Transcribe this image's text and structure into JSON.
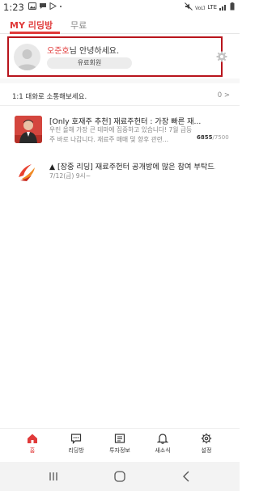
{
  "status_bar": {
    "time": "1:23",
    "network": "LTE",
    "icons": [
      "gallery-icon",
      "message-icon",
      "play-store-icon",
      "dot-icon",
      "mute-icon",
      "volte-icon",
      "signal-icon",
      "battery-icon"
    ]
  },
  "tabs": [
    {
      "label": "MY 리딩방",
      "active": true
    },
    {
      "label": "무료",
      "active": false
    }
  ],
  "profile": {
    "user_name": "오준호",
    "greeting_suffix": "님 안녕하세요.",
    "member_type": "유료회원"
  },
  "chat_prompt": {
    "text": "1:1 대화로 소통해보세요.",
    "count": "0",
    "chevron": ">"
  },
  "rooms": [
    {
      "title": "[Only 호재주 추천] 재료주헌터 : 가장 빠른 재...",
      "description": "우린 올해 가장 큰 테마에 집중하고 있습니다! 7월 급등주 바로 나갑니다. 재료주 매매 및 향후 관련...",
      "participants": "6855",
      "capacity": "/7500"
    },
    {
      "title": "▲ [장중 리딩] 재료주헌터 공개방에 많은 참여 부탁드...",
      "date": "7/12(금) 9시~"
    }
  ],
  "bottom_nav": [
    {
      "label": "홈",
      "icon": "home-icon",
      "active": true
    },
    {
      "label": "리딩방",
      "icon": "chat-bubble-icon",
      "active": false
    },
    {
      "label": "투자정보",
      "icon": "document-icon",
      "active": false
    },
    {
      "label": "새소식",
      "icon": "bell-icon",
      "active": false
    },
    {
      "label": "설정",
      "icon": "gear-icon",
      "active": false
    }
  ],
  "colors": {
    "accent": "#e03a3a",
    "highlight_border": "#b8141c"
  }
}
